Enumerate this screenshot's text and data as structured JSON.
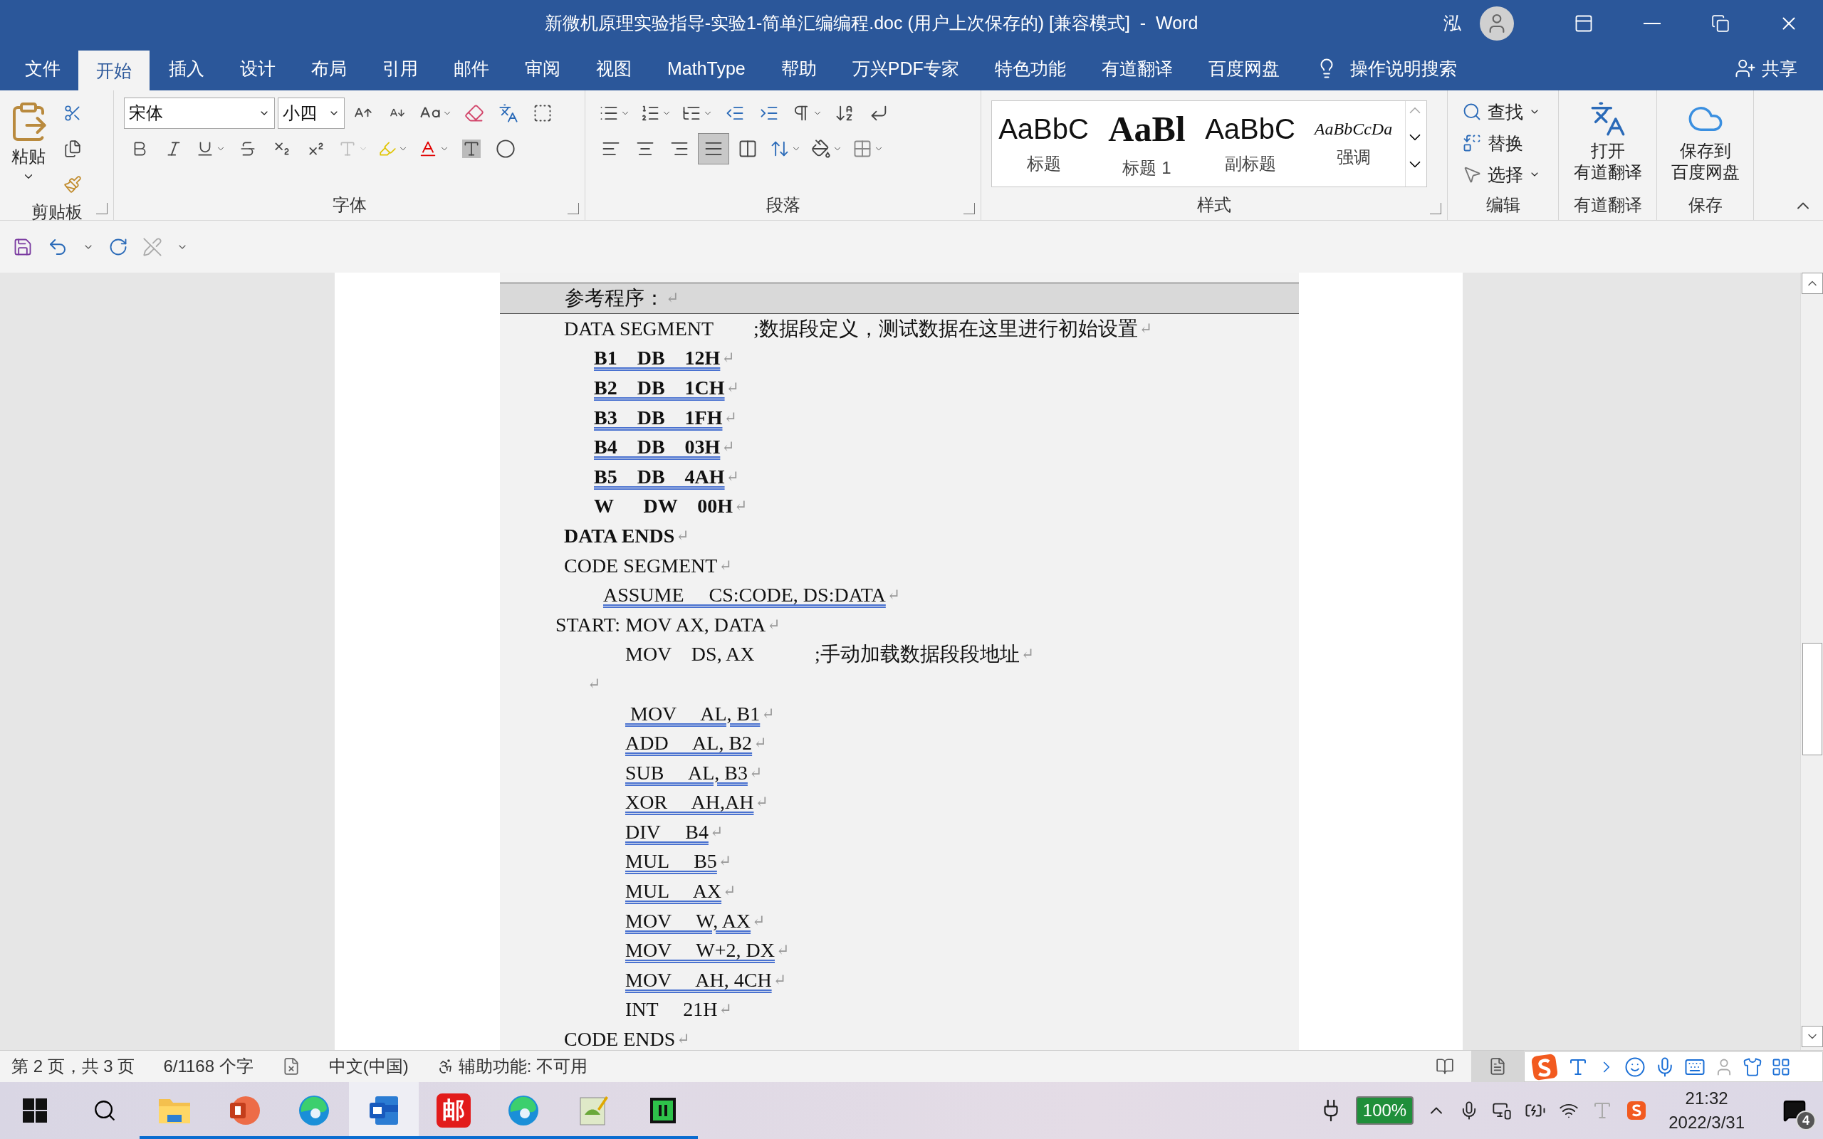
{
  "window": {
    "title": "新微机原理实验指导-实验1-简单汇编编程.doc (用户上次保存的) [兼容模式]  -  Word",
    "user": "泓"
  },
  "tabs": [
    {
      "label": "文件",
      "selected": false
    },
    {
      "label": "开始",
      "selected": true
    },
    {
      "label": "插入",
      "selected": false
    },
    {
      "label": "设计",
      "selected": false
    },
    {
      "label": "布局",
      "selected": false
    },
    {
      "label": "引用",
      "selected": false
    },
    {
      "label": "邮件",
      "selected": false
    },
    {
      "label": "审阅",
      "selected": false
    },
    {
      "label": "视图",
      "selected": false
    },
    {
      "label": "MathType",
      "selected": false
    },
    {
      "label": "帮助",
      "selected": false
    },
    {
      "label": "万兴PDF专家",
      "selected": false
    },
    {
      "label": "特色功能",
      "selected": false
    },
    {
      "label": "有道翻译",
      "selected": false
    },
    {
      "label": "百度网盘",
      "selected": false
    }
  ],
  "tell_me": "操作说明搜索",
  "share": "共享",
  "ribbon": {
    "clipboard": {
      "paste": "粘贴",
      "label": "剪贴板"
    },
    "font": {
      "font_name": "宋体",
      "font_size": "小四",
      "label": "字体"
    },
    "paragraph": {
      "label": "段落",
      "align": [
        {
          "kind": "left",
          "selected": false
        },
        {
          "kind": "center",
          "selected": false
        },
        {
          "kind": "right",
          "selected": false
        },
        {
          "kind": "justify",
          "selected": true
        },
        {
          "kind": "distributed",
          "selected": false
        }
      ]
    },
    "styles": {
      "label": "样式",
      "items": [
        {
          "kind": "title",
          "sample": "AaBbC",
          "name": "标题"
        },
        {
          "kind": "heading1",
          "sample": "AaBl",
          "name": "标题 1"
        },
        {
          "kind": "subtitle",
          "sample": "AaBbC",
          "name": "副标题"
        },
        {
          "kind": "emphasis",
          "sample": "AaBbCcDa",
          "name": "强调"
        }
      ]
    },
    "editing": {
      "label": "编辑",
      "find": "查找",
      "replace": "替换",
      "select": "选择"
    },
    "translate": {
      "button": [
        "打开",
        "有道翻译"
      ],
      "label": "有道翻译"
    },
    "save": {
      "button": [
        "保存到",
        "百度网盘"
      ],
      "label": "保存"
    }
  },
  "document": {
    "heading": "参考程序：",
    "heading_mark": "↵",
    "lines": [
      {
        "kind": "segment",
        "code": "DATA SEGMENT",
        "comment": ";数据段定义，测试数据在这里进行初始设置",
        "bold": false,
        "flagged": false,
        "return_mark": "↵"
      },
      {
        "kind": "field",
        "code": "B1    DB    12H",
        "bold": true,
        "flagged": true,
        "return_mark": "↵"
      },
      {
        "kind": "field",
        "code": "B2    DB    1CH",
        "bold": true,
        "flagged": true,
        "return_mark": "↵"
      },
      {
        "kind": "field",
        "code": "B3    DB    1FH",
        "bold": true,
        "flagged": true,
        "return_mark": "↵"
      },
      {
        "kind": "field",
        "code": "B4    DB    03H",
        "bold": true,
        "flagged": true,
        "return_mark": "↵"
      },
      {
        "kind": "field",
        "code": "B5    DB    4AH",
        "bold": true,
        "flagged": true,
        "return_mark": "↵"
      },
      {
        "kind": "field",
        "code": "W      DW    00H",
        "bold": true,
        "flagged": false,
        "return_mark": "↵"
      },
      {
        "kind": "segment",
        "code": "DATA ENDS",
        "bold": true,
        "flagged": false,
        "return_mark": "↵"
      },
      {
        "kind": "segment",
        "code": "CODE SEGMENT",
        "bold": false,
        "flagged": false,
        "return_mark": "↵"
      },
      {
        "kind": "directive",
        "code": "ASSUME     CS:CODE, DS:DATA",
        "bold": false,
        "flagged": true,
        "return_mark": "↵"
      },
      {
        "kind": "label",
        "code": "START: MOV AX, DATA",
        "bold": false,
        "flagged": false,
        "return_mark": "↵"
      },
      {
        "kind": "instruction",
        "code": "MOV    DS, AX",
        "comment": ";手动加载数据段段地址",
        "bold": false,
        "flagged": false,
        "return_mark": "↵"
      },
      {
        "kind": "blank",
        "return_mark": "↵"
      },
      {
        "kind": "instruction",
        "code": " MOV     AL, B1",
        "bold": false,
        "flagged": true,
        "return_mark": "↵"
      },
      {
        "kind": "instruction",
        "code": "ADD     AL, B2",
        "bold": false,
        "flagged": true,
        "return_mark": "↵"
      },
      {
        "kind": "instruction",
        "code": "SUB     AL, B3",
        "bold": false,
        "flagged": true,
        "return_mark": "↵"
      },
      {
        "kind": "instruction",
        "code": "XOR     AH,AH",
        "bold": false,
        "flagged": true,
        "return_mark": "↵"
      },
      {
        "kind": "instruction",
        "code": "DIV     B4",
        "bold": false,
        "flagged": true,
        "return_mark": "↵"
      },
      {
        "kind": "instruction",
        "code": "MUL     B5",
        "bold": false,
        "flagged": true,
        "return_mark": "↵"
      },
      {
        "kind": "instruction",
        "code": "MUL     AX",
        "bold": false,
        "flagged": true,
        "return_mark": "↵"
      },
      {
        "kind": "instruction",
        "code": "MOV     W, AX",
        "bold": false,
        "flagged": true,
        "return_mark": "↵"
      },
      {
        "kind": "instruction",
        "code": "MOV     W+2, DX",
        "bold": false,
        "flagged": true,
        "return_mark": "↵"
      },
      {
        "kind": "instruction",
        "code": "MOV     AH, 4CH",
        "bold": false,
        "flagged": true,
        "return_mark": "↵"
      },
      {
        "kind": "instruction",
        "code": "INT     21H",
        "bold": false,
        "flagged": false,
        "return_mark": "↵"
      },
      {
        "kind": "segment",
        "code": "CODE ENDS",
        "bold": false,
        "flagged": false,
        "return_mark": "↵"
      }
    ]
  },
  "status_bar": {
    "page": "第 2 页，共 3 页",
    "words": "6/1168 个字",
    "language": "中文(中国)",
    "accessibility": "辅助功能: 不可用",
    "views": [
      {
        "kind": "read",
        "selected": false
      },
      {
        "kind": "print",
        "selected": true
      }
    ]
  },
  "taskbar": {
    "apps": [
      {
        "kind": "explorer",
        "selected": false
      },
      {
        "kind": "powerpoint",
        "selected": false
      },
      {
        "kind": "edge",
        "selected": false
      },
      {
        "kind": "word",
        "selected": true
      },
      {
        "kind": "mail",
        "glyph": "邮",
        "selected": false
      },
      {
        "kind": "edge",
        "selected": false
      },
      {
        "kind": "notepad",
        "selected": false
      },
      {
        "kind": "chip",
        "selected": false
      }
    ],
    "battery": "100%",
    "time": "21:32",
    "date": "2022/3/31",
    "notifications": "4"
  }
}
